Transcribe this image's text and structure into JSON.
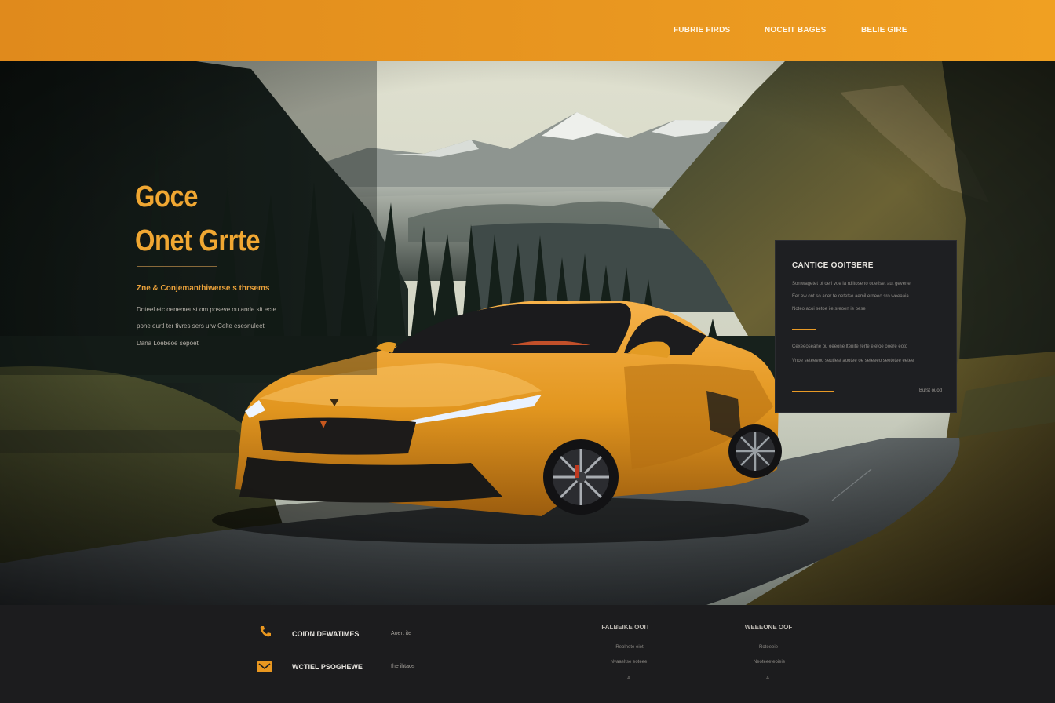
{
  "header": {
    "nav": [
      {
        "label": "FUBRIE FIRDS"
      },
      {
        "label": "NOCEIT BAGES"
      },
      {
        "label": "BELIE GIRE"
      }
    ]
  },
  "hero": {
    "title_line1": "Goce",
    "title_line2": "Onet Grrte",
    "subtitle": "Zne & Conjemanthiwerse s thrsems",
    "body_lines": [
      "Dnteel etc oenemeust om poseve ou ande sit ecte",
      "pone ourtl ter tivres sers urw Celte esesnuleet",
      "Dana Loebeoe sepoet"
    ]
  },
  "panel": {
    "title": "CANTICE OOITSERE",
    "lines_a": [
      "Sonlwagetet of oerl voe la rdlitoseno ouetiset aut gevene",
      "Eer ew ont so aner te oetetso aemil erneeo sro weeaaia",
      "Noteo acoi setoe ile sreoen ie oese"
    ],
    "lines_b": [
      "Cexeeoseane ou oeeone ltenite rerte eletoe ooere eoto",
      "Vnoe seteeeoo seutiest aootee oe seteeeo seetetee eetee"
    ],
    "link": "Burst ouod"
  },
  "footer": {
    "contacts": [
      {
        "icon": "phone-icon",
        "label": "COIDN DEWATIMES",
        "value": "Aoert ite"
      },
      {
        "icon": "mail-icon",
        "label": "WCTIEL PSOGHEWE",
        "value": "Ihe ihtaos"
      }
    ],
    "columns": [
      {
        "heading": "FALBEIKE OOIT",
        "items": [
          "Reolnete eiet",
          "Nvaaeltse eoteee",
          "A"
        ]
      },
      {
        "heading": "WEEEONE OOF",
        "items": [
          "Roteeeie",
          "Neoteeeteoieie",
          "A"
        ]
      }
    ]
  },
  "colors": {
    "accent": "#e99720",
    "title": "#f0a732",
    "footer_bg": "#1c1c1e",
    "panel_bg": "#1e1f22"
  }
}
